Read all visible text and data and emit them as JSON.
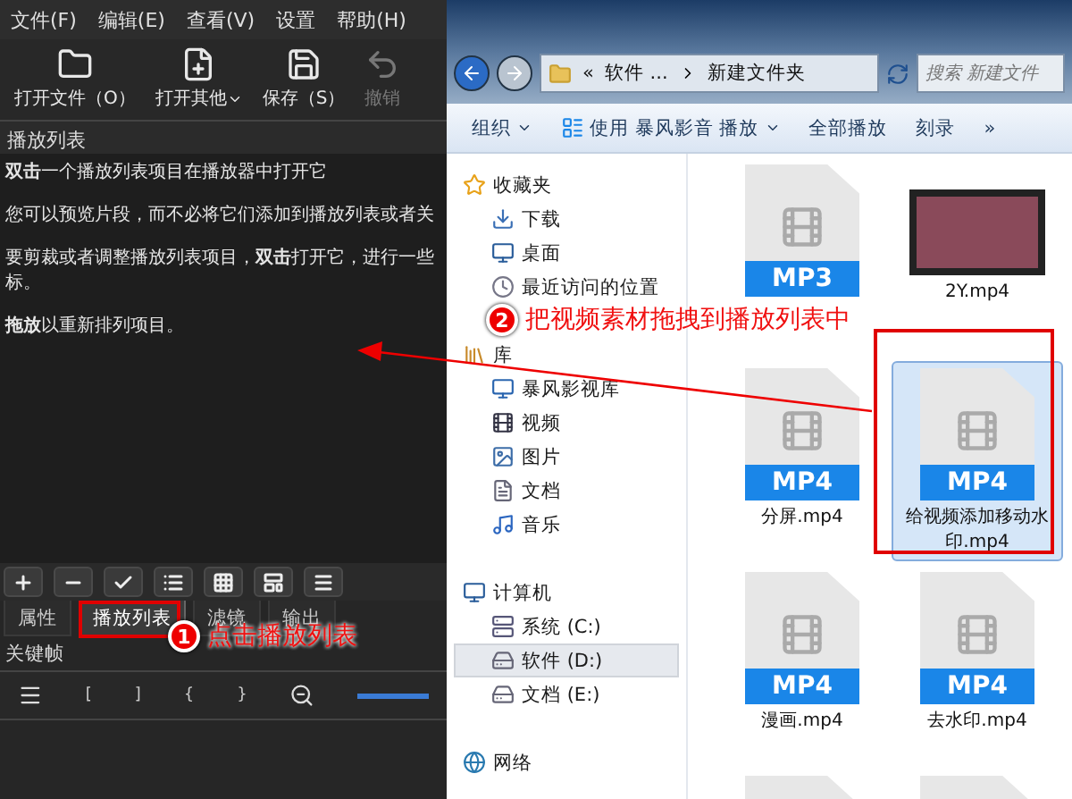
{
  "menu": [
    "文件(F)",
    "编辑(E)",
    "查看(V)",
    "设置",
    "帮助(H)"
  ],
  "toolbar": [
    {
      "label": "打开文件（O）",
      "dropdown": false,
      "disabled": false
    },
    {
      "label": "打开其他",
      "dropdown": true,
      "disabled": false
    },
    {
      "label": "保存（S）",
      "dropdown": false,
      "disabled": false
    },
    {
      "label": "撤销",
      "dropdown": false,
      "disabled": true
    }
  ],
  "playlist": {
    "title": "播放列表",
    "paragraphs": [
      {
        "lines": [
          "**双击**一个播放列表项目在播放器中打开它"
        ]
      },
      {
        "lines": [
          "您可以预览片段，而不必将它们添加到播放列表或者关"
        ]
      },
      {
        "lines": [
          "要剪裁或者调整播放列表项目，**双击**打开它，进行一些",
          "标。"
        ]
      },
      {
        "lines": [
          "**拖放**以重新排列项目。"
        ]
      }
    ]
  },
  "panel_tabs": [
    {
      "label": "属性",
      "selected": false
    },
    {
      "label": "播放列表",
      "selected": true
    },
    {
      "label": "滤镜",
      "selected": false
    },
    {
      "label": "输出",
      "selected": false
    }
  ],
  "keyframes": {
    "title": "关键帧",
    "marks": [
      "[",
      "]",
      "{",
      "}"
    ]
  },
  "explorer": {
    "breadcrumb": [
      "«",
      "软件 ...",
      "新建文件夹"
    ],
    "search": {
      "placeholder": "搜索 新建文件"
    },
    "toolbar": [
      {
        "label": "组织",
        "dropdown": true,
        "icon": false
      },
      {
        "label": "使用 暴风影音 播放",
        "dropdown": true,
        "icon": true
      },
      {
        "label": "全部播放",
        "dropdown": false,
        "icon": false
      },
      {
        "label": "刻录",
        "dropdown": false,
        "icon": false
      },
      {
        "label": "»",
        "dropdown": false,
        "icon": false
      }
    ],
    "sidebar": [
      {
        "label": "收藏夹",
        "children": [
          {
            "label": "下载",
            "selected": false
          },
          {
            "label": "桌面",
            "selected": false
          },
          {
            "label": "最近访问的位置",
            "selected": false
          }
        ]
      },
      {
        "label": "库",
        "children": [
          {
            "label": "暴风影视库",
            "selected": false
          },
          {
            "label": "视频",
            "selected": false
          },
          {
            "label": "图片",
            "selected": false
          },
          {
            "label": "文档",
            "selected": false
          },
          {
            "label": "音乐",
            "selected": false
          }
        ]
      },
      {
        "label": "计算机",
        "children": [
          {
            "label": "系统 (C:)",
            "selected": false
          },
          {
            "label": "软件 (D:)",
            "selected": true
          },
          {
            "label": "文档 (E:)",
            "selected": false
          }
        ]
      },
      {
        "label": "网络"
      }
    ],
    "files": [
      {
        "kind": "doc",
        "badge": "MP3",
        "selected": false
      },
      {
        "kind": "video",
        "name": "2Y.mp4",
        "selected": false
      },
      {
        "kind": "doc",
        "badge": "MP4",
        "name": "分屏.mp4",
        "selected": false
      },
      {
        "kind": "doc",
        "badge": "MP4",
        "name": "给视频添加移动水印.mp4",
        "selected": true
      },
      {
        "kind": "doc",
        "badge": "MP4",
        "name": "漫画.mp4",
        "selected": false
      },
      {
        "kind": "doc",
        "badge": "MP4",
        "name": "去水印.mp4",
        "selected": false
      },
      {
        "kind": "doc",
        "selected": false
      },
      {
        "kind": "doc",
        "selected": false
      }
    ]
  },
  "annotations": [
    {
      "number": "2",
      "text": "把视频素材拖拽到播放列表中"
    },
    {
      "number": "1",
      "text": "点击播放列表"
    }
  ]
}
